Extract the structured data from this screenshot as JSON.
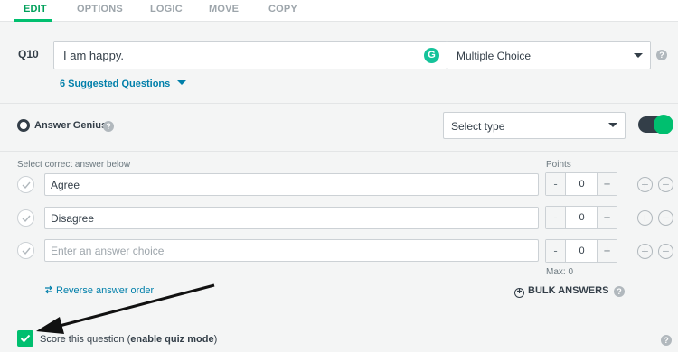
{
  "tabs": [
    {
      "label": "EDIT",
      "active": true
    },
    {
      "label": "OPTIONS",
      "active": false
    },
    {
      "label": "LOGIC",
      "active": false
    },
    {
      "label": "MOVE",
      "active": false
    },
    {
      "label": "COPY",
      "active": false
    }
  ],
  "question": {
    "number": "Q10",
    "text": "I am happy.",
    "grammarly_icon": "G",
    "type": "Multiple Choice",
    "suggested": "6 Suggested Questions"
  },
  "answer_genius": {
    "label": "Answer Genius",
    "select_placeholder": "Select type",
    "toggle_on": true
  },
  "answers": {
    "header_label": "Select correct answer below",
    "points_label": "Points",
    "rows": [
      {
        "text": "Agree",
        "points": "0"
      },
      {
        "text": "Disagree",
        "points": "0"
      },
      {
        "text": "",
        "placeholder": "Enter an answer choice",
        "points": "0"
      }
    ],
    "max_label": "Max: 0",
    "reverse_label": "Reverse answer order",
    "bulk_label": "BULK ANSWERS"
  },
  "score": {
    "checked": true,
    "label_prefix": "Score this question (",
    "label_bold": "enable quiz mode",
    "label_suffix": ")"
  },
  "colors": {
    "accent_green": "#00bf6f",
    "link_blue": "#007faa",
    "text_dark": "#333e48"
  },
  "icons": [
    "grammarly-icon",
    "chevron-down-icon",
    "help-icon",
    "answer-genius-icon",
    "check-icon",
    "plus-icon",
    "minus-icon",
    "reverse-icon",
    "bulk-add-icon",
    "checkbox-check-icon",
    "arrow-annotation"
  ]
}
